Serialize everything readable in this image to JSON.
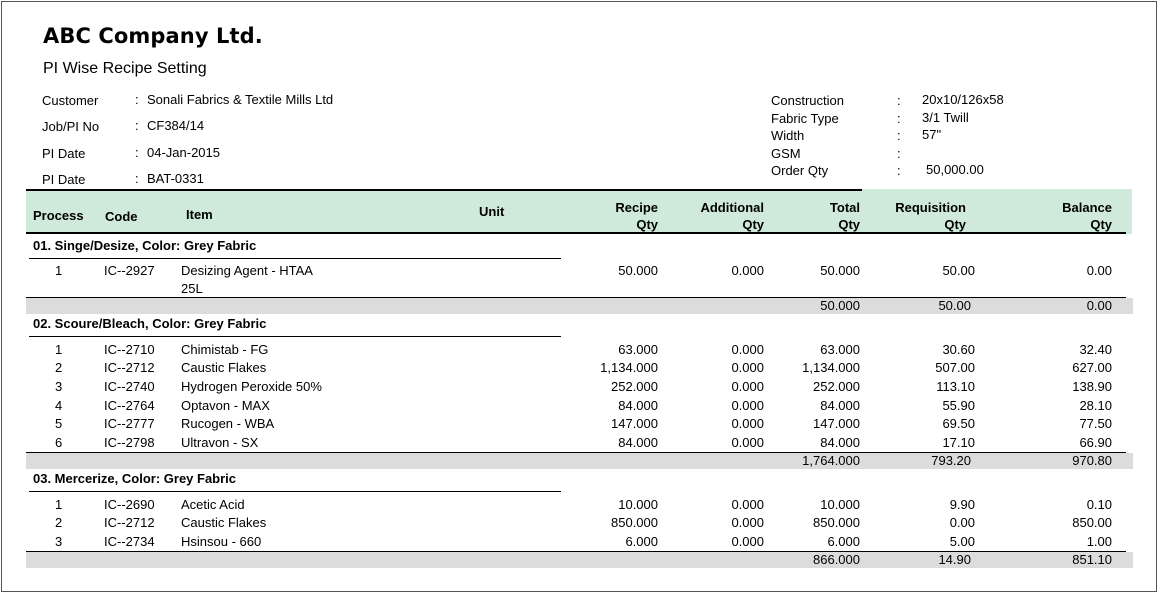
{
  "header": {
    "company": "ABC Company Ltd.",
    "report_title": "PI Wise Recipe Setting"
  },
  "info_left": [
    {
      "label": "Customer",
      "value": "Sonali Fabrics & Textile Mills Ltd"
    },
    {
      "label": "Job/PI No",
      "value": "CF384/14"
    },
    {
      "label": "PI Date",
      "value": "04-Jan-2015"
    },
    {
      "label": "PI Date",
      "value": "BAT-0331"
    }
  ],
  "info_right": [
    {
      "label": "Construction",
      "value": "20x10/126x58"
    },
    {
      "label": "Fabric Type",
      "value": "3/1 Twill"
    },
    {
      "label": "Width",
      "value": "57\""
    },
    {
      "label": "GSM",
      "value": ""
    },
    {
      "label": "Order Qty",
      "value": "50,000.00"
    }
  ],
  "colon": ":",
  "columns": {
    "process": "Process",
    "code": "Code",
    "item": "Item",
    "unit": "Unit",
    "recipe_1": "Recipe",
    "recipe_2": "Qty",
    "additional_1": "Additional",
    "additional_2": "Qty",
    "total_1": "Total",
    "total_2": "Qty",
    "requisition_1": "Requisition",
    "requisition_2": "Qty",
    "balance_1": "Balance",
    "balance_2": "Qty"
  },
  "groups": [
    {
      "title": "01. Singe/Desize,  Color: Grey Fabric",
      "rows": [
        {
          "sl": "1",
          "code": "IC--2927",
          "item": "Desizing Agent - HTAA",
          "item2": "25L",
          "recipe": "50.000",
          "additional": "0.000",
          "total": "50.000",
          "requisition": "50.00",
          "balance": "0.00"
        }
      ],
      "subtotal": {
        "total": "50.000",
        "requisition": "50.00",
        "balance": "0.00"
      }
    },
    {
      "title": "02. Scoure/Bleach,  Color: Grey Fabric",
      "rows": [
        {
          "sl": "1",
          "code": "IC--2710",
          "item": "Chimistab - FG",
          "recipe": "63.000",
          "additional": "0.000",
          "total": "63.000",
          "requisition": "30.60",
          "balance": "32.40"
        },
        {
          "sl": "2",
          "code": "IC--2712",
          "item": "Caustic Flakes",
          "recipe": "1,134.000",
          "additional": "0.000",
          "total": "1,134.000",
          "requisition": "507.00",
          "balance": "627.00"
        },
        {
          "sl": "3",
          "code": "IC--2740",
          "item": "Hydrogen Peroxide 50%",
          "recipe": "252.000",
          "additional": "0.000",
          "total": "252.000",
          "requisition": "113.10",
          "balance": "138.90"
        },
        {
          "sl": "4",
          "code": "IC--2764",
          "item": "Optavon - MAX",
          "recipe": "84.000",
          "additional": "0.000",
          "total": "84.000",
          "requisition": "55.90",
          "balance": "28.10"
        },
        {
          "sl": "5",
          "code": "IC--2777",
          "item": "Rucogen - WBA",
          "recipe": "147.000",
          "additional": "0.000",
          "total": "147.000",
          "requisition": "69.50",
          "balance": "77.50"
        },
        {
          "sl": "6",
          "code": "IC--2798",
          "item": "Ultravon - SX",
          "recipe": "84.000",
          "additional": "0.000",
          "total": "84.000",
          "requisition": "17.10",
          "balance": "66.90"
        }
      ],
      "subtotal": {
        "total": "1,764.000",
        "requisition": "793.20",
        "balance": "970.80"
      }
    },
    {
      "title": "03. Mercerize,  Color: Grey Fabric",
      "rows": [
        {
          "sl": "1",
          "code": "IC--2690",
          "item": "Acetic Acid",
          "recipe": "10.000",
          "additional": "0.000",
          "total": "10.000",
          "requisition": "9.90",
          "balance": "0.10"
        },
        {
          "sl": "2",
          "code": "IC--2712",
          "item": "Caustic Flakes",
          "recipe": "850.000",
          "additional": "0.000",
          "total": "850.000",
          "requisition": "0.00",
          "balance": "850.00"
        },
        {
          "sl": "3",
          "code": "IC--2734",
          "item": "Hsinsou - 660",
          "recipe": "6.000",
          "additional": "0.000",
          "total": "6.000",
          "requisition": "5.00",
          "balance": "1.00"
        }
      ],
      "subtotal": {
        "total": "866.000",
        "requisition": "14.90",
        "balance": "851.10"
      }
    }
  ]
}
